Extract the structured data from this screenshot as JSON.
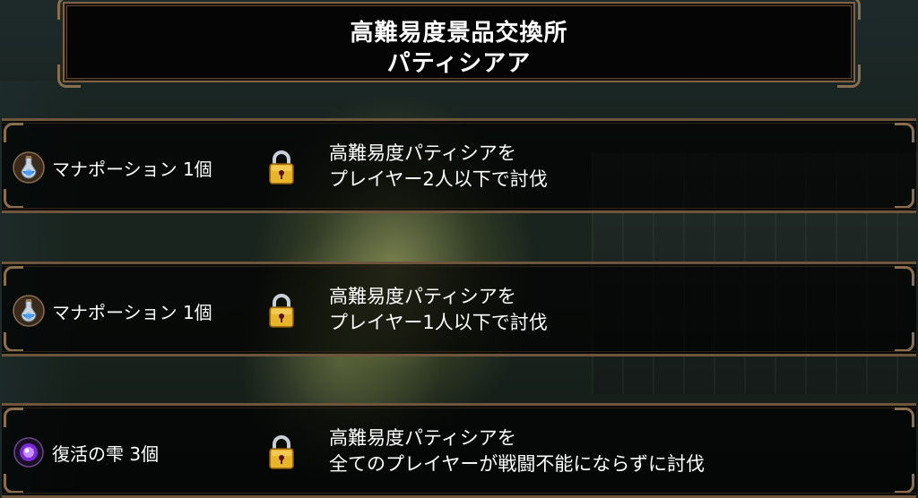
{
  "header": {
    "title_line1": "高難易度景品交換所",
    "title_line2": "パティシアア"
  },
  "rewards": [
    {
      "item": "マナポーション 1個",
      "icon": "mana-potion-icon",
      "locked": true,
      "condition_line1": "高難易度パティシアを",
      "condition_line2": "プレイヤー2人以下で討伐"
    },
    {
      "item": "マナポーション 1個",
      "icon": "mana-potion-icon",
      "locked": true,
      "condition_line1": "高難易度パティシアを",
      "condition_line2": "プレイヤー1人以下で討伐"
    },
    {
      "item": "復活の雫 3個",
      "icon": "revival-drop-icon",
      "locked": true,
      "condition_line1": "高難易度パティシアを",
      "condition_line2": "全てのプレイヤーが戦闘不能にならずに討伐"
    }
  ],
  "colors": {
    "frame": "#7d6246",
    "panel": "#050505",
    "text": "#ffffff",
    "lock_gold": "#e8b52a"
  }
}
